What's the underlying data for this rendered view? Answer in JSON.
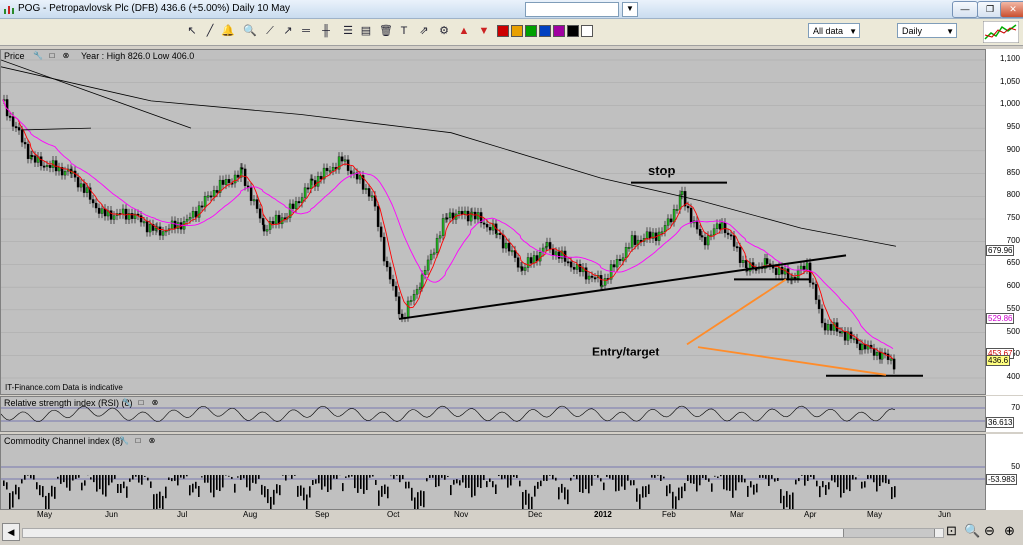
{
  "window": {
    "title": "POG - Petropavlovsk Plc (DFB)   436.6 (+5.00%)   Daily  10 May",
    "symbol_value": ""
  },
  "toolbar": {
    "range_select": "All data",
    "interval_select": "Daily"
  },
  "price_panel": {
    "label": "Price",
    "info": "Year : High 826.0 Low 406.0",
    "watermark": "IT-Finance.com  Data is indicative",
    "axis_ticks": [
      "1,100",
      "1,050",
      "1,000",
      "950",
      "900",
      "850",
      "800",
      "750",
      "700",
      "650",
      "600",
      "550",
      "500",
      "450",
      "400"
    ],
    "axis_tags": [
      "679.96",
      "529.86",
      "453.67",
      "436.6"
    ],
    "annotations": {
      "stop": "stop",
      "entry": "Entry/target"
    }
  },
  "rsi_panel": {
    "label": "Relative strength index (RSI) (8)",
    "axis_ticks": [
      "70"
    ],
    "axis_tags": [
      "36.613"
    ]
  },
  "cci_panel": {
    "label": "Commodity Channel index (8)",
    "axis_ticks": [
      "50"
    ],
    "axis_tags": [
      "-53.983"
    ]
  },
  "x_axis": [
    "May",
    "Jun",
    "Jul",
    "Aug",
    "Sep",
    "Oct",
    "Nov",
    "Dec",
    "2012",
    "Feb",
    "Mar",
    "Apr",
    "May",
    "Jun"
  ],
  "colors": {
    "ema_fast": "#ff0000",
    "ema_mid": "#ff00ff",
    "ema_slow": "#000000",
    "orange_line": "#ff8c2a",
    "bg": "#c0c0c0"
  },
  "icons": [
    "chart-app-icon",
    "settings-icon",
    "pointer-icon",
    "zoom-icon",
    "crosshair-icon",
    "trendline-icon",
    "fibonacci-icon",
    "text-icon",
    "delete-icon"
  ]
}
